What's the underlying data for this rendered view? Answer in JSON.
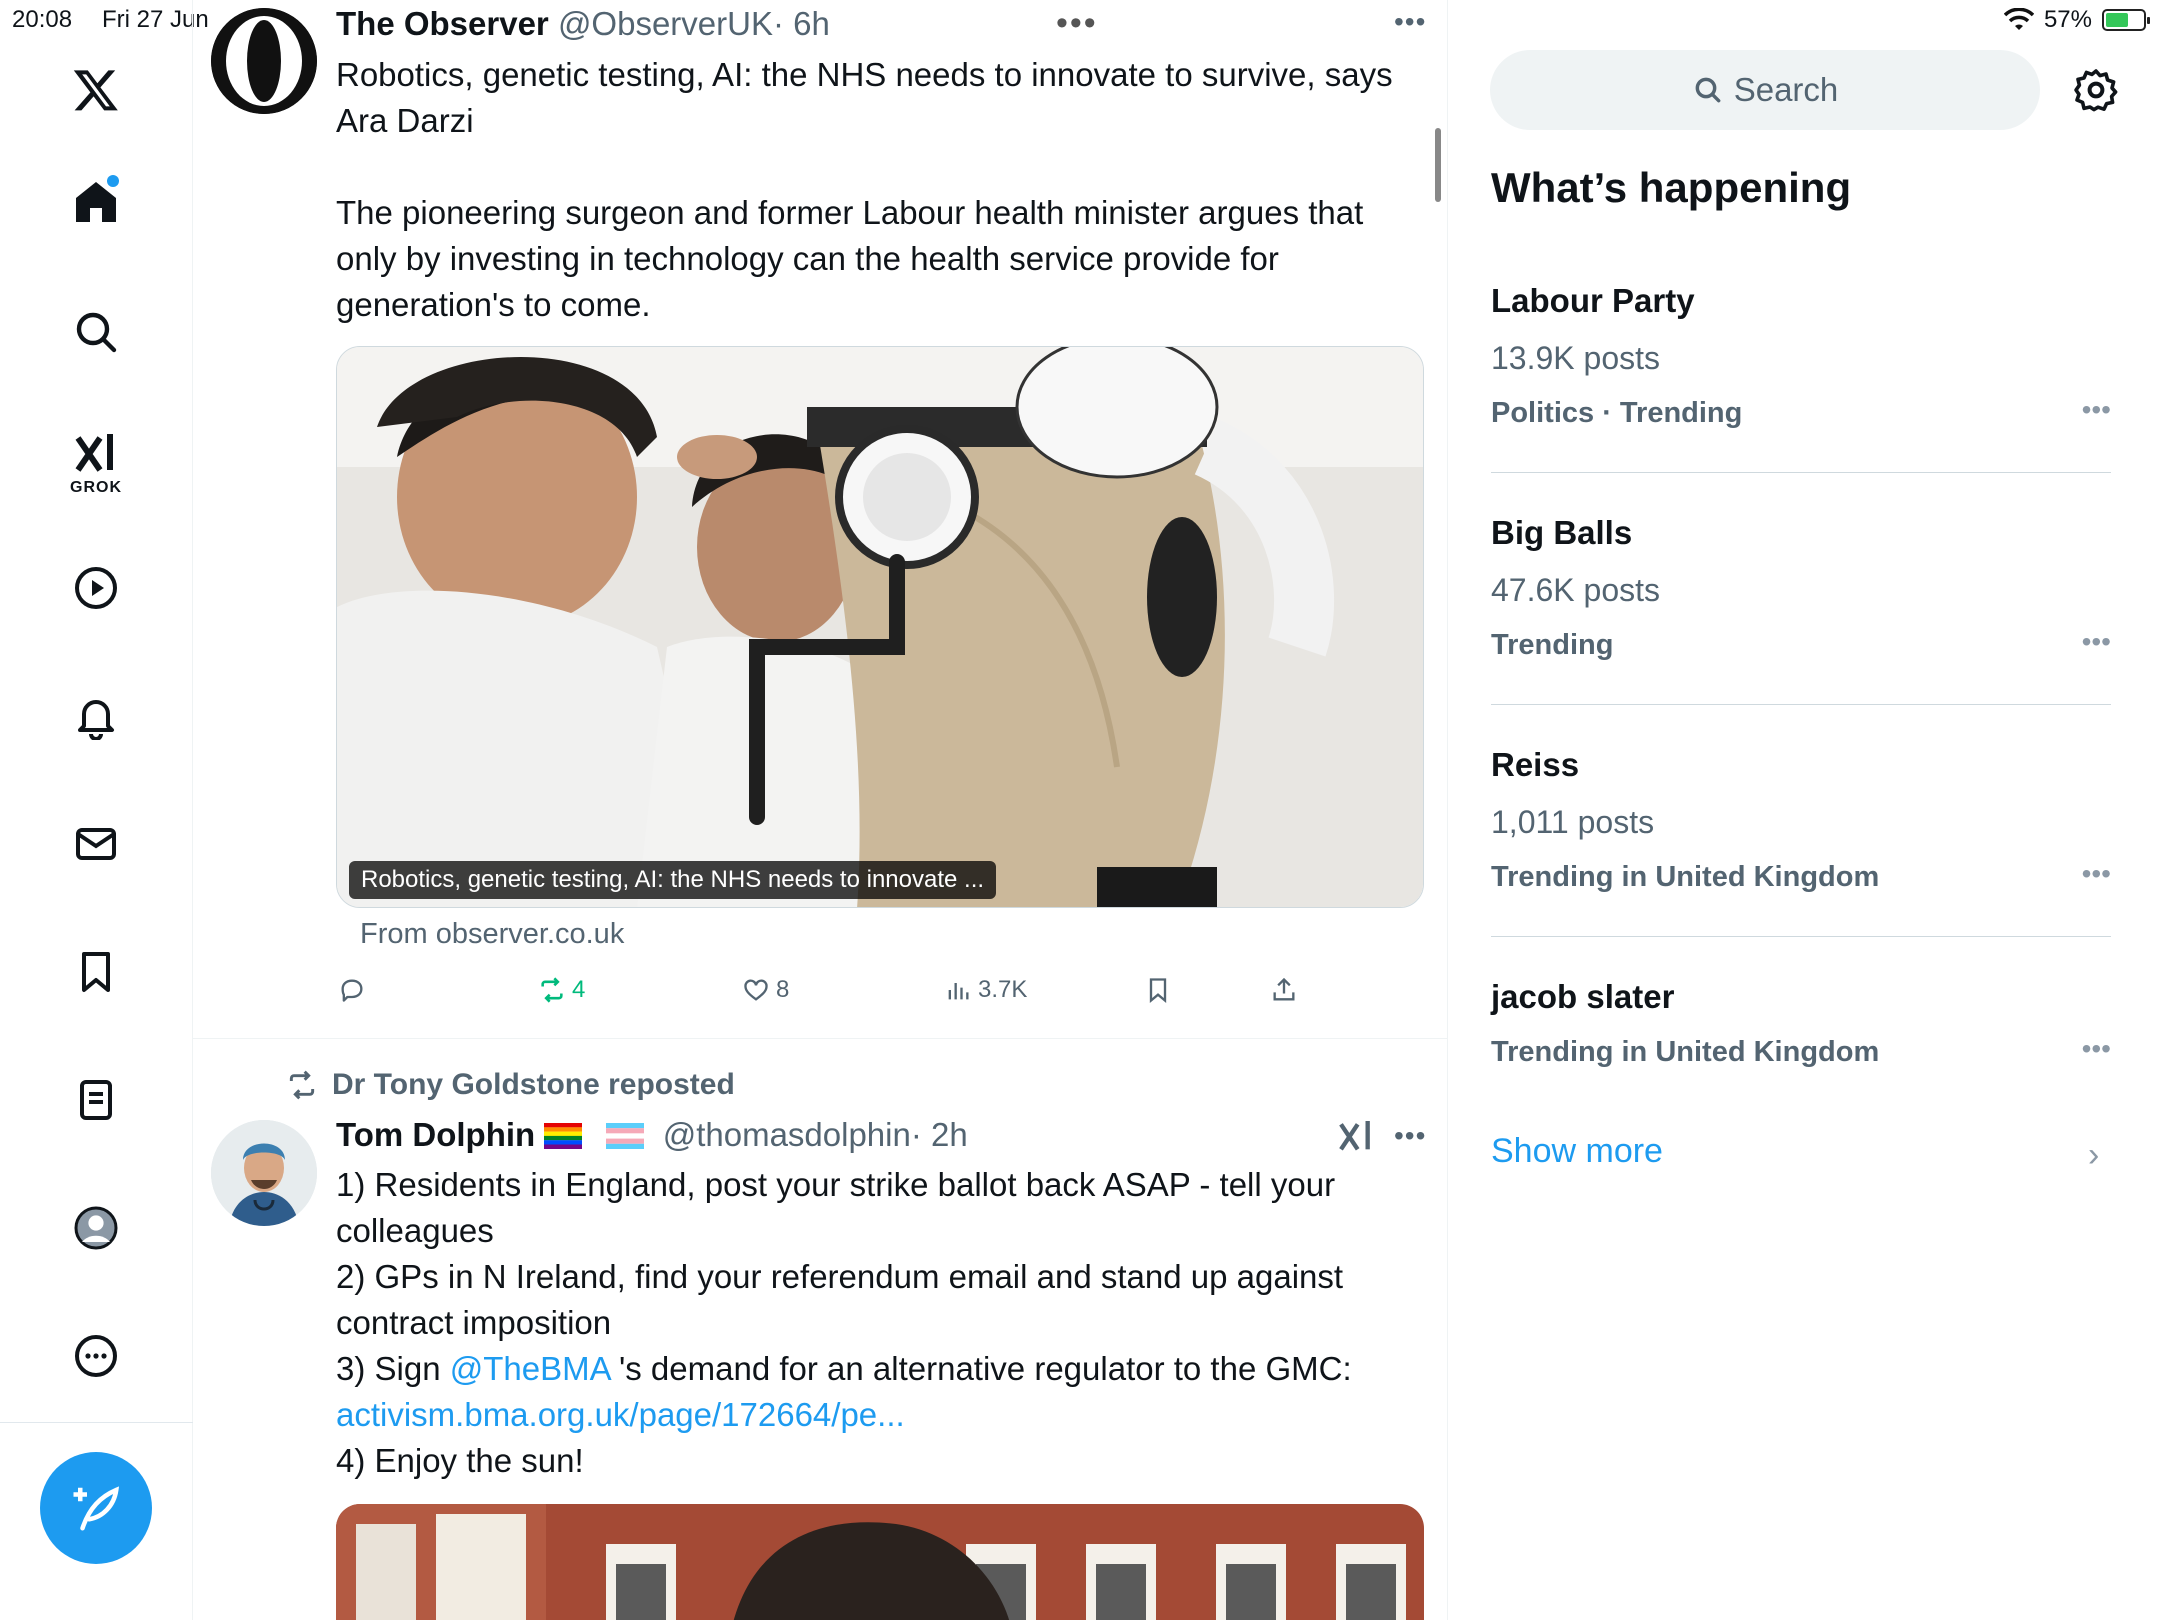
{
  "status_bar": {
    "time": "20:08",
    "date": "Fri 27 Jun",
    "battery": "57%"
  },
  "sidebar": {
    "grok_label": "GROK",
    "items": [
      "x-logo",
      "home",
      "explore",
      "grok",
      "video",
      "notifications",
      "messages",
      "bookmarks",
      "lists",
      "profile",
      "more"
    ]
  },
  "tweet1": {
    "name": "The Observer",
    "handle": "@ObserverUK",
    "time": "· 6h",
    "lines": [
      "Robotics, genetic testing, AI: the NHS needs to innovate to survive, says",
      "Ara Darzi",
      "",
      "The pioneering surgeon and former Labour health minister argues that",
      "only by investing in technology can the health service provide for",
      "generation's to come."
    ],
    "card_caption": "Robotics, genetic testing, AI: the NHS needs to innovate ...",
    "card_source": "From observer.co.uk",
    "reposts": "4",
    "likes": "8",
    "views": "3.7K"
  },
  "tweet2": {
    "reposted_by": "Dr Tony Goldstone reposted",
    "name": "Tom Dolphin",
    "handle": "@thomasdolphin",
    "time": "· 2h",
    "line1": "1) Residents in England, post your strike ballot back ASAP - tell your",
    "line2": "colleagues",
    "line3": "2) GPs in N Ireland, find your referendum email and stand up against",
    "line4": "contract imposition",
    "line5_pre": "3) Sign ",
    "line5_mention": "@TheBMA",
    "line5_post": " 's demand for an alternative regulator to the GMC:",
    "line6_link": "activism.bma.org.uk/page/172664/pe...",
    "line7": "4) Enjoy the sun!"
  },
  "right": {
    "search_placeholder": "Search",
    "section_title": "What’s happening",
    "trends": [
      {
        "name": "Labour Party",
        "count": "13.9K posts",
        "category": "Politics · Trending"
      },
      {
        "name": "Big Balls",
        "count": "47.6K posts",
        "category": "Trending"
      },
      {
        "name": "Reiss",
        "count": "1,011 posts",
        "category": "Trending in United Kingdom"
      },
      {
        "name": "jacob slater",
        "count": "",
        "category": "Trending in United Kingdom"
      }
    ],
    "show_more": "Show more"
  },
  "colors": {
    "accent": "#1d9bf0",
    "repost_green": "#00ba7c",
    "secondary_text": "#536471"
  }
}
